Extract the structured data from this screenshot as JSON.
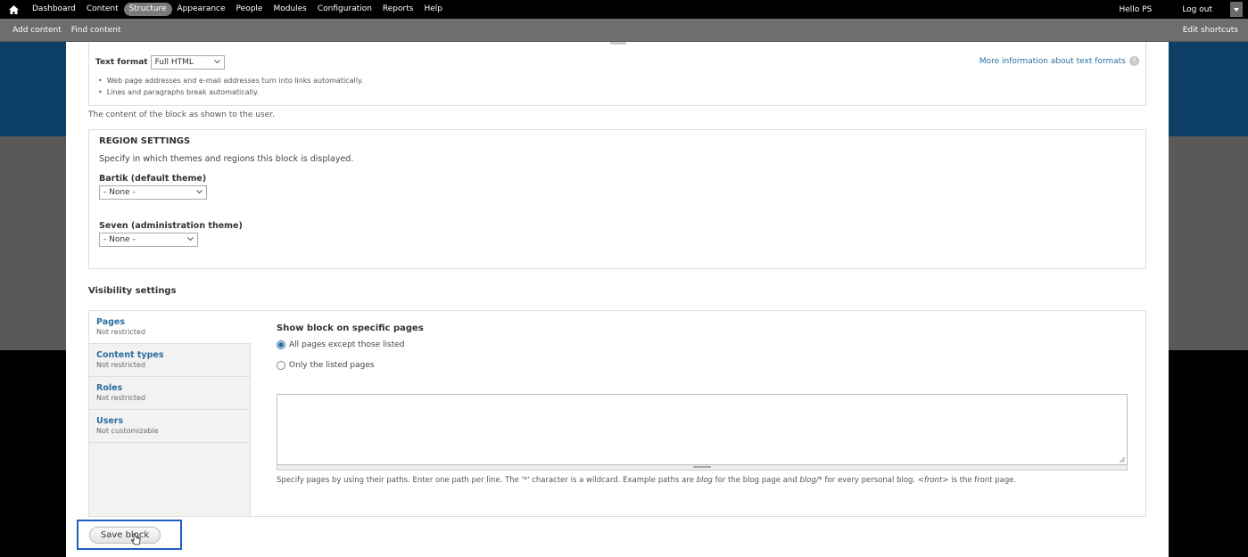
{
  "toolbar": {
    "home_icon": "home-icon",
    "items": [
      "Dashboard",
      "Content",
      "Structure",
      "Appearance",
      "People",
      "Modules",
      "Configuration",
      "Reports",
      "Help"
    ],
    "active": "Structure",
    "hello": "Hello",
    "username": "PS",
    "logout": "Log out"
  },
  "shortcuts": {
    "add_content": "Add content",
    "find_content": "Find content",
    "edit_shortcuts": "Edit shortcuts"
  },
  "text_format": {
    "label": "Text format",
    "value": "Full HTML",
    "tips": [
      "Web page addresses and e-mail addresses turn into links automatically.",
      "Lines and paragraphs break automatically."
    ],
    "more_info": "More information about text formats"
  },
  "block_body_description": "The content of the block as shown to the user.",
  "region": {
    "title": "REGION SETTINGS",
    "description": "Specify in which themes and regions this block is displayed.",
    "bartik_label": "Bartik (default theme)",
    "bartik_value": "- None -",
    "seven_label": "Seven (administration theme)",
    "seven_value": "- None -"
  },
  "visibility": {
    "title": "Visibility settings",
    "tabs": [
      {
        "title": "Pages",
        "summary": "Not restricted"
      },
      {
        "title": "Content types",
        "summary": "Not restricted"
      },
      {
        "title": "Roles",
        "summary": "Not restricted"
      },
      {
        "title": "Users",
        "summary": "Not customizable"
      }
    ],
    "pane_title": "Show block on specific pages",
    "radio_all": "All pages except those listed",
    "radio_only": "Only the listed pages",
    "selected": "All pages except those listed",
    "desc_1": "Specify pages by using their paths. Enter one path per line. The '*' character is a wildcard. Example paths are ",
    "desc_blog": "blog",
    "desc_2": " for the blog page and ",
    "desc_blogstar": "blog/*",
    "desc_3": " for every personal blog. ",
    "desc_front": "<front>",
    "desc_4": " is the front page."
  },
  "save_button": "Save block",
  "colors": {
    "link": "#2a6ea0",
    "highlight": "#1f5fbf",
    "toolbar": "#000000",
    "shortcuts_bar": "#6e6e6e"
  }
}
